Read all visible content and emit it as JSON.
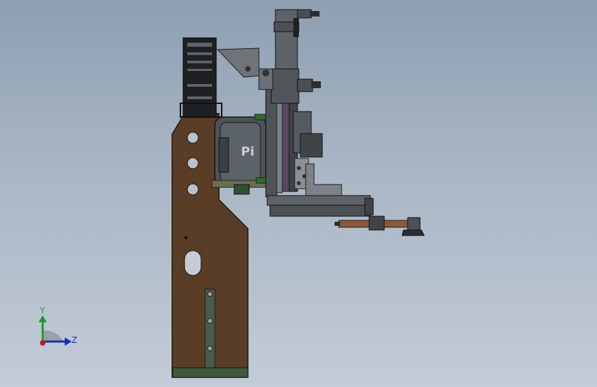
{
  "viewport": {
    "background_top": "#8e9fb2",
    "background_bottom": "#c3ccd7"
  },
  "model": {
    "colors": {
      "bracket_plate": "#5a3d26",
      "dark_steel": "#3f4447",
      "mid_steel": "#5d6367",
      "light_steel": "#8a9094",
      "green_part": "#2f6b2a",
      "purple_part": "#5a4660",
      "copper_rod": "#8a5a3a",
      "cable_chain": "#1e2022",
      "base_strip": "#3d5a3d"
    },
    "motor_label": "Pi"
  },
  "triad": {
    "y_label": "Y",
    "z_label": "Z",
    "y_color": "#1f9b2a",
    "z_color": "#1a2fb8",
    "x_color": "#c41a1a"
  }
}
